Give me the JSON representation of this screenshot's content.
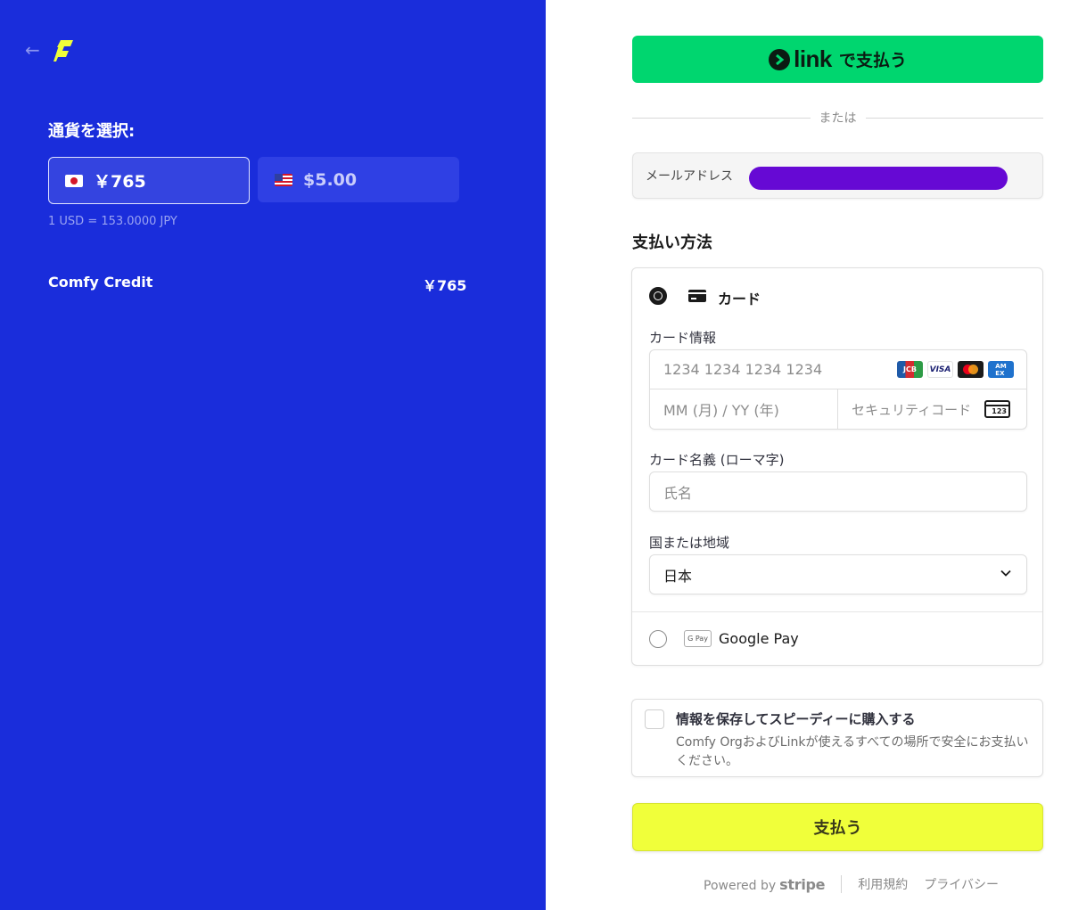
{
  "left": {
    "currency_title": "通貨を選択:",
    "currencies": [
      {
        "flag": "jp-flag",
        "amount": "￥765",
        "selected": true
      },
      {
        "flag": "us-flag",
        "amount": "$5.00",
        "selected": false
      }
    ],
    "exchange_rate": "1 USD = 153.0000 JPY",
    "item": {
      "name": "Comfy Credit",
      "price": "￥765"
    }
  },
  "link_button": {
    "brand": "link",
    "label": "で支払う"
  },
  "divider_text": "または",
  "email": {
    "label": "メールアドレス",
    "value_redacted": true
  },
  "payment_method": {
    "title": "支払い方法",
    "card_option_label": "カード",
    "card_info_label": "カード情報",
    "card_number_placeholder": "1234 1234 1234 1234",
    "expiry_placeholder": "MM (月) / YY (年)",
    "cvc_placeholder": "セキュリティコード",
    "cvc_icon_text": "123",
    "brands": [
      "JCB",
      "VISA",
      "Mastercard",
      "AMEX"
    ],
    "cardholder_label": "カード名義 (ローマ字)",
    "cardholder_placeholder": "氏名",
    "country_label": "国または地域",
    "country_value": "日本",
    "gpay_icon_text": "G Pay",
    "gpay_label": "Google Pay"
  },
  "save_info": {
    "title": "情報を保存してスピーディーに購入する",
    "description": "Comfy OrgおよびLinkが使えるすべての場所で安全にお支払いください。"
  },
  "pay_button": "支払う",
  "footer": {
    "powered_by": "Powered by",
    "stripe": "stripe",
    "terms": "利用規約",
    "privacy": "プライバシー"
  },
  "colors": {
    "left_bg": "#1a2ddb",
    "link_green": "#00d66f",
    "pay_yellow": "#f0ff3a",
    "logo_yellow": "#f0ff3a"
  }
}
